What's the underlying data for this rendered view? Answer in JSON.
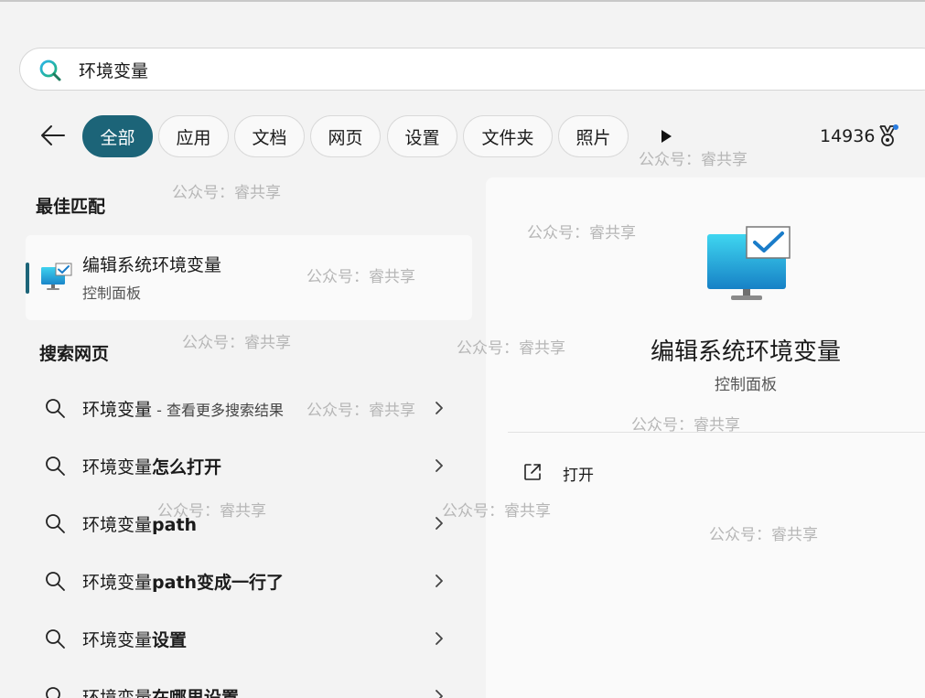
{
  "search": {
    "query": "环境变量"
  },
  "filters": [
    "全部",
    "应用",
    "文档",
    "网页",
    "设置",
    "文件夹",
    "照片"
  ],
  "rewards": {
    "points": "14936"
  },
  "best_match": {
    "section_title": "最佳匹配",
    "title": "编辑系统环境变量",
    "subtitle": "控制面板"
  },
  "web_search": {
    "section_title": "搜索网页",
    "results": [
      {
        "prefix": "环境变量",
        "bold": "",
        "suffix": " - 查看更多搜索结果"
      },
      {
        "prefix": "环境变量",
        "bold": "怎么打开",
        "suffix": ""
      },
      {
        "prefix": "环境变量",
        "bold": "path",
        "suffix": ""
      },
      {
        "prefix": "环境变量",
        "bold": "path变成一行了",
        "suffix": ""
      },
      {
        "prefix": "环境变量",
        "bold": "设置",
        "suffix": ""
      },
      {
        "prefix": "环境变量",
        "bold": "在哪里设置",
        "suffix": ""
      }
    ]
  },
  "detail": {
    "title": "编辑系统环境变量",
    "subtitle": "控制面板",
    "action_open": "打开"
  },
  "watermark": "公众号：睿共享",
  "colors": {
    "accent": "#1c6478",
    "background": "#f3f3f3",
    "pane": "#fafafa"
  }
}
